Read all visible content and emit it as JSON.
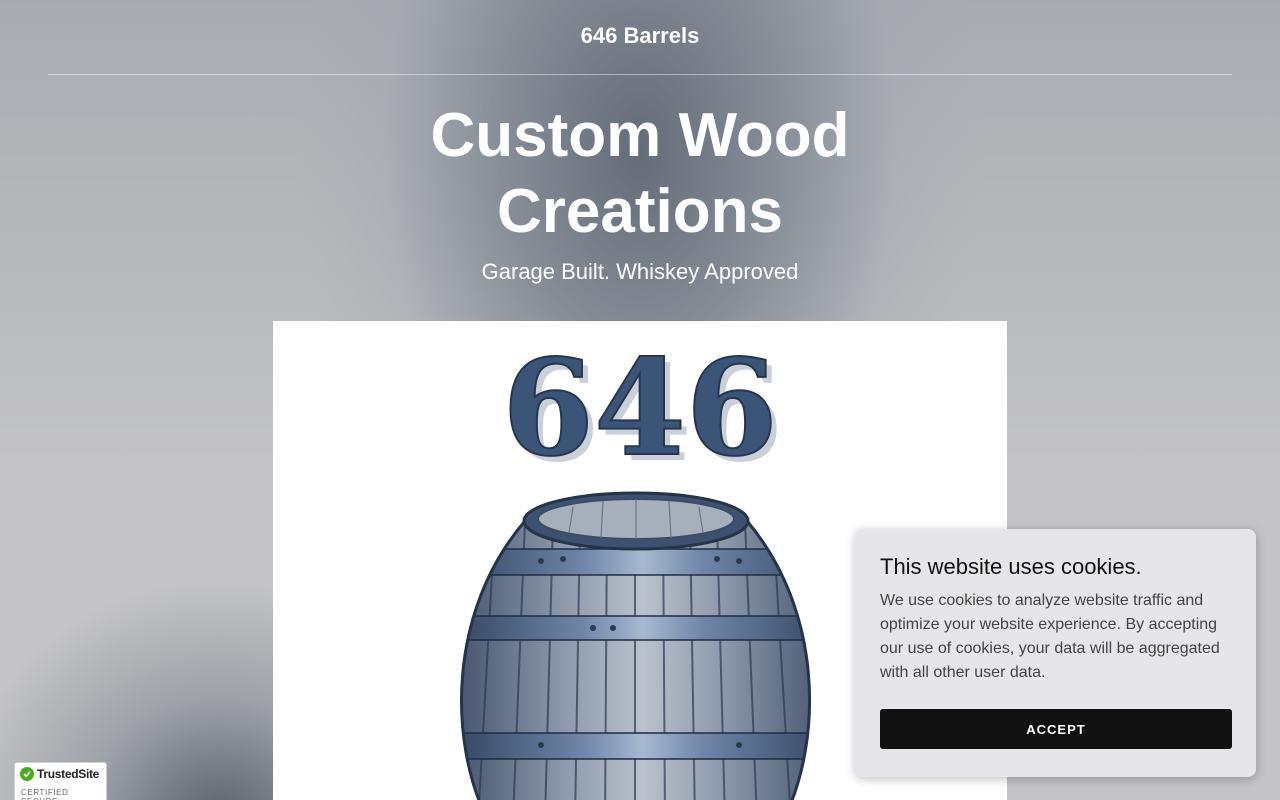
{
  "header": {
    "site_title": "646 Barrels"
  },
  "hero": {
    "title_line1": "Custom Wood",
    "title_line2": "Creations",
    "subtitle": "Garage Built. Whiskey Approved"
  },
  "logo": {
    "number_text": "646"
  },
  "cookie_banner": {
    "title": "This website uses cookies.",
    "body": "We use cookies to analyze website traffic and optimize your website experience. By accepting our use of cookies, your data will be aggregated with all other user data.",
    "accept_label": "ACCEPT"
  },
  "trust_badge": {
    "name": "TrustedSite",
    "tagline": "CERTIFIED SECURE"
  },
  "colors": {
    "background": "#c4c4c6",
    "logo_blue": "#3b5578",
    "cookie_bg": "#e6e6ea",
    "accept_bg": "#111111",
    "trust_green": "#4caa1d"
  }
}
